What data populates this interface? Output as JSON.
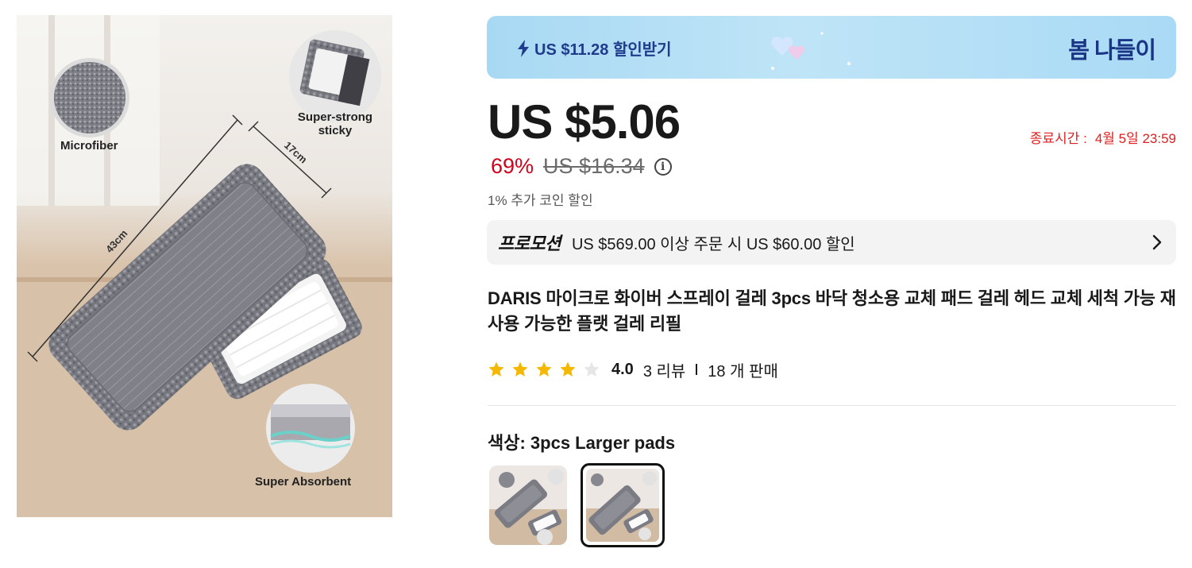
{
  "image": {
    "labels": {
      "microfiber": "Microfiber",
      "super_sticky": "Super-strong\nsticky",
      "super_absorbent": "Super Absorbent",
      "width": "17cm",
      "length": "43cm"
    }
  },
  "banner": {
    "coupon_text": "US $11.28 할인받기",
    "event_title": "봄 나들이"
  },
  "pricing": {
    "current_price": "US $5.06",
    "discount_percent": "69%",
    "original_price": "US $16.34",
    "coin_note": "1% 추가 코인 할인",
    "end_time_label": "종료시간 :",
    "end_time_value": "4월 5일 23:59"
  },
  "promotion": {
    "tag": "프로모션",
    "text": "US $569.00 이상 주문 시 US $60.00 할인"
  },
  "product": {
    "title": "DARIS 마이크로 화이버 스프레이 걸레 3pcs 바닥 청소용 교체 패드 걸레 헤드 교체 세척 가능 재사용 가능한 플랫 걸레 리필",
    "rating": 4.0,
    "rating_text": "4.0",
    "reviews": "3 리뷰",
    "sold": "18 개 판매"
  },
  "variant": {
    "label": "색상: 3pcs Larger pads",
    "options": [
      "option-1",
      "option-2"
    ],
    "selected_index": 1
  },
  "colors": {
    "accent_red": "#e02020",
    "discount_red": "#d0021b",
    "banner_blue": "#a8d9f3",
    "star_gold": "#f5b800",
    "star_empty": "#e6e6e6"
  }
}
